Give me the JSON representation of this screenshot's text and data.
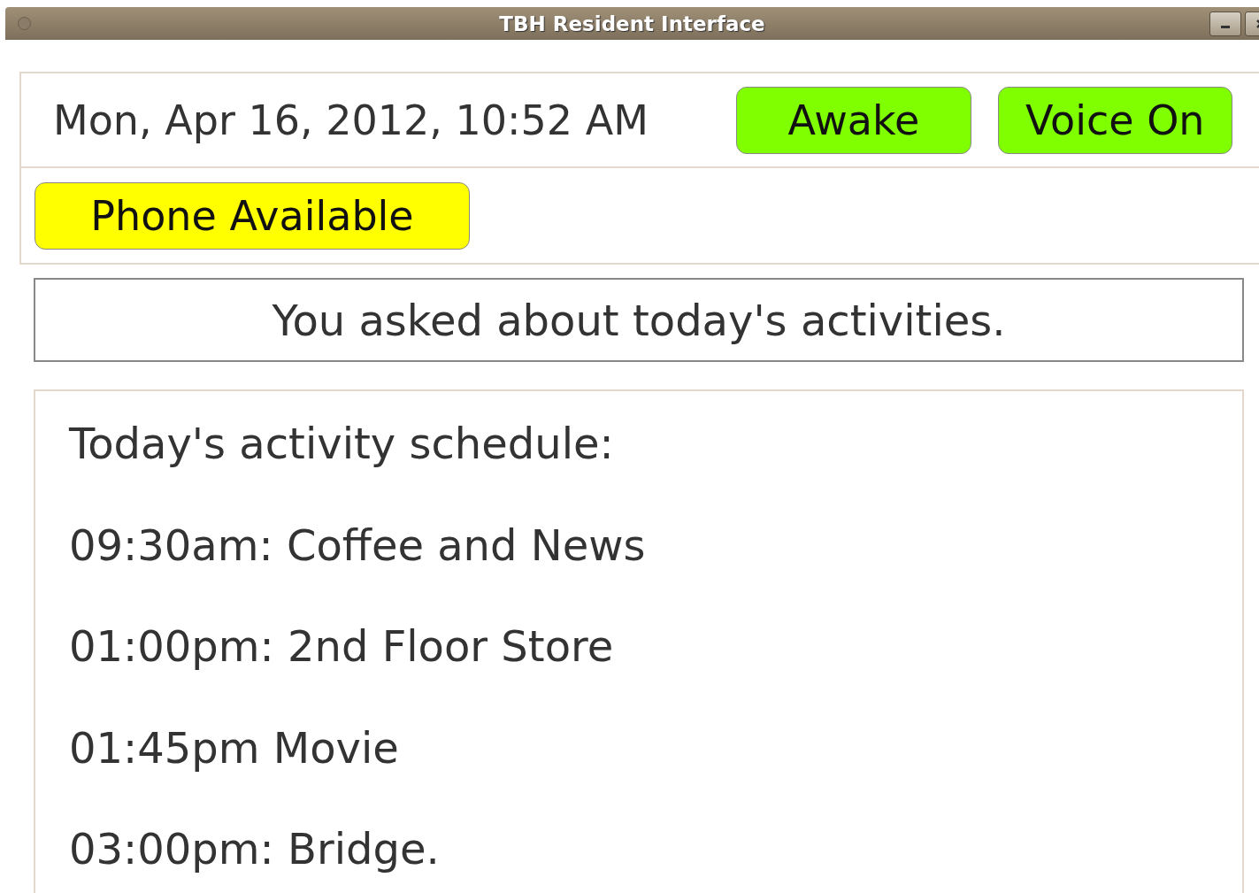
{
  "window": {
    "title": "TBH Resident Interface"
  },
  "datetime": "Mon, Apr 16, 2012, 10:52 AM",
  "status_buttons": [
    {
      "label": "Awake",
      "color": "#80ff00"
    },
    {
      "label": "Voice On",
      "color": "#80ff00"
    }
  ],
  "phone_button": {
    "label": "Phone Available",
    "color": "#ffff00"
  },
  "message": "You asked about today's activities.",
  "schedule": {
    "heading": "Today's activity schedule:",
    "items": [
      "09:30am: Coffee and News",
      "01:00pm: 2nd Floor Store",
      "01:45pm Movie",
      "03:00pm: Bridge."
    ]
  }
}
